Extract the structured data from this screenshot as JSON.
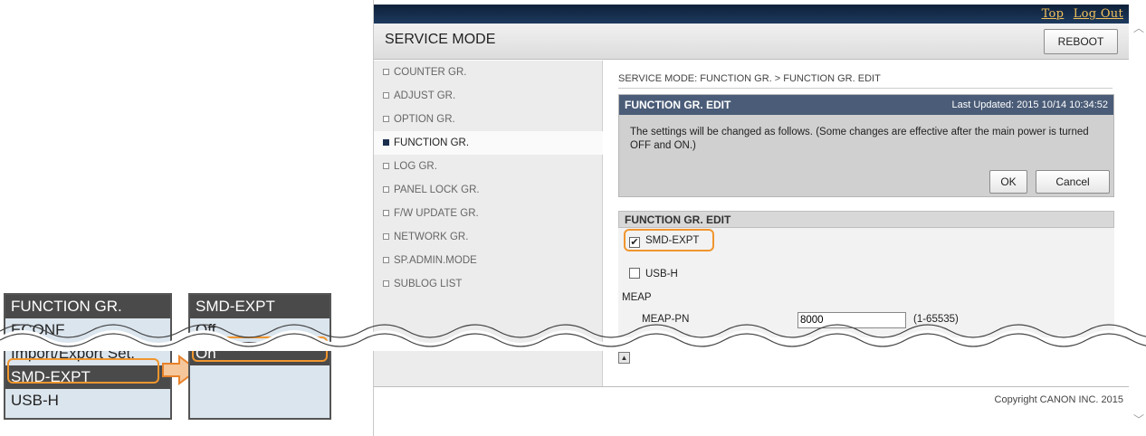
{
  "lcd_menu": {
    "header": "FUNCTION GR.",
    "items": [
      "ECONF",
      "Import/Export Set.",
      "SMD-EXPT",
      "USB-H"
    ],
    "selected_index": 2
  },
  "lcd_submenu": {
    "header": "SMD-EXPT",
    "items": [
      "Off",
      "On"
    ],
    "selected_index": 1
  },
  "browser": {
    "top_links": [
      "Top",
      "Log Out"
    ],
    "title": "SERVICE MODE",
    "reboot_label": "REBOOT",
    "sidebar": [
      {
        "label": "COUNTER GR.",
        "active": false
      },
      {
        "label": "ADJUST GR.",
        "active": false
      },
      {
        "label": "OPTION GR.",
        "active": false
      },
      {
        "label": "FUNCTION GR.",
        "active": true
      },
      {
        "label": "LOG GR.",
        "active": false
      },
      {
        "label": "PANEL LOCK GR.",
        "active": false
      },
      {
        "label": "F/W UPDATE GR.",
        "active": false
      },
      {
        "label": "NETWORK GR.",
        "active": false
      },
      {
        "label": "SP.ADMIN.MODE",
        "active": false
      },
      {
        "label": "SUBLOG LIST",
        "active": false
      }
    ],
    "breadcrumb": "SERVICE MODE: FUNCTION GR. > FUNCTION GR. EDIT",
    "confirm": {
      "header": "FUNCTION GR. EDIT",
      "last_updated": "Last Updated: 2015 10/14 10:34:52",
      "message": "The settings will be changed as follows. (Some changes are effective after the main power is turned OFF and ON.)",
      "ok_label": "OK",
      "cancel_label": "Cancel"
    },
    "edit": {
      "header": "FUNCTION GR. EDIT",
      "smd_expt_label": "SMD-EXPT",
      "smd_expt_checked": true,
      "usb_h_label": "USB-H",
      "usb_h_checked": false,
      "meap_label": "MEAP",
      "meap_pn_label": "MEAP-PN",
      "meap_pn_value": "8000",
      "meap_pn_range": "(1-65535)"
    },
    "copyright": "Copyright CANON INC. 2015"
  },
  "colors": {
    "highlight": "#f0962e",
    "header_dark": "#4a5c77",
    "topbar": "#0e2038",
    "link": "#f3c15b"
  }
}
